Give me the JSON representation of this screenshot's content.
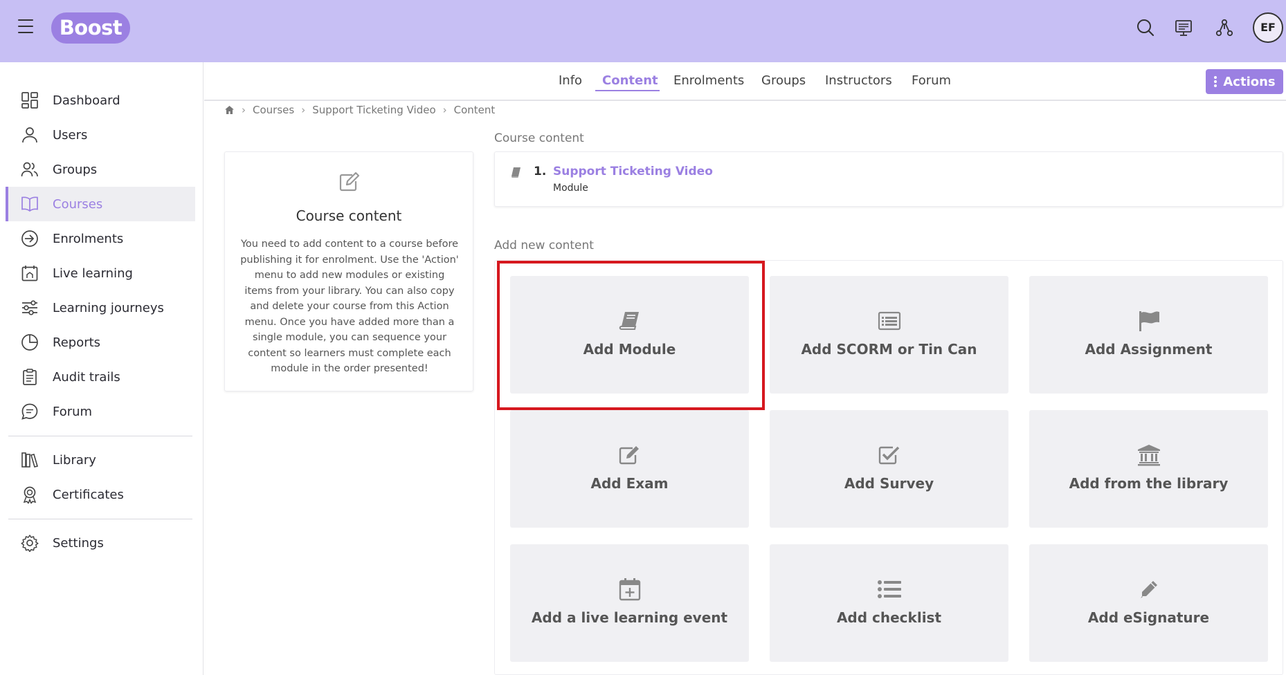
{
  "header": {
    "logo_text": "Boost",
    "avatar_initials": "EF",
    "icons": [
      "menu-icon",
      "search-icon",
      "presentation-icon",
      "network-icon"
    ]
  },
  "sidebar": {
    "items": [
      {
        "label": "Dashboard",
        "icon": "dashboard-icon"
      },
      {
        "label": "Users",
        "icon": "user-icon"
      },
      {
        "label": "Groups",
        "icon": "groups-icon"
      },
      {
        "label": "Courses",
        "icon": "book-open-icon",
        "active": true
      },
      {
        "label": "Enrolments",
        "icon": "sign-in-icon"
      },
      {
        "label": "Live learning",
        "icon": "calendar-icon"
      },
      {
        "label": "Learning journeys",
        "icon": "sliders-icon"
      },
      {
        "label": "Reports",
        "icon": "pie-chart-icon"
      },
      {
        "label": "Audit trails",
        "icon": "clipboard-icon"
      },
      {
        "label": "Forum",
        "icon": "chat-icon"
      },
      {
        "label": "Library",
        "icon": "library-icon"
      },
      {
        "label": "Certificates",
        "icon": "award-icon"
      },
      {
        "label": "Settings",
        "icon": "gear-icon"
      }
    ]
  },
  "tabs": [
    {
      "label": "Info"
    },
    {
      "label": "Content",
      "active": true
    },
    {
      "label": "Enrolments"
    },
    {
      "label": "Groups"
    },
    {
      "label": "Instructors"
    },
    {
      "label": "Forum"
    }
  ],
  "actions_label": "Actions",
  "breadcrumb": [
    "Courses",
    "Support Ticketing Video",
    "Content"
  ],
  "info_card": {
    "title": "Course content",
    "description": "You need to add content to a course before publishing it for enrolment. Use the 'Action' menu to add new modules or existing items from your library. You can also copy and delete your course from this Action menu. Once you have added more than a single module, you can sequence your content so learners must complete each module in the order presented!"
  },
  "course_content": {
    "heading": "Course content",
    "items": [
      {
        "number": "1.",
        "name": "Support Ticketing Video",
        "type": "Module"
      }
    ]
  },
  "add_new": {
    "heading": "Add new content",
    "tiles": [
      {
        "label": "Add Module",
        "icon": "book-icon"
      },
      {
        "label": "Add SCORM or Tin Can",
        "icon": "list-alt-icon"
      },
      {
        "label": "Add Assignment",
        "icon": "flag-icon"
      },
      {
        "label": "Add Exam",
        "icon": "edit-icon"
      },
      {
        "label": "Add Survey",
        "icon": "check-square-icon"
      },
      {
        "label": "Add from the library",
        "icon": "institution-icon"
      },
      {
        "label": "Add a live learning event",
        "icon": "calendar-plus-icon"
      },
      {
        "label": "Add checklist",
        "icon": "list-icon"
      },
      {
        "label": "Add eSignature",
        "icon": "pencil-icon"
      }
    ]
  },
  "colors": {
    "topbar": "#c7bff4",
    "accent": "#9b80e2",
    "highlight": "#d6181f"
  }
}
